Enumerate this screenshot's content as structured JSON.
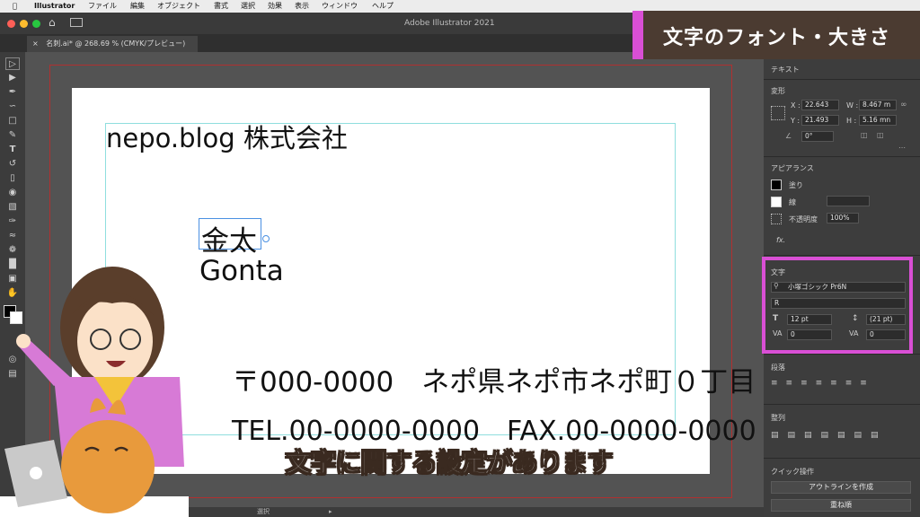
{
  "menubar": {
    "app": "Illustrator",
    "items": [
      "ファイル",
      "編集",
      "オブジェクト",
      "書式",
      "選択",
      "効果",
      "表示",
      "ウィンドウ",
      "ヘルプ"
    ]
  },
  "window": {
    "title": "Adobe Illustrator 2021"
  },
  "document_tab": {
    "label": "名刺.ai* @ 268.69 % (CMYK/プレビュー)",
    "close": "×"
  },
  "artboard": {
    "company": "nepo.blog 株式会社",
    "name_jp": "金太",
    "name_en": "Gonta",
    "address": "〒000-0000　ネポ県ネポ市ネポ町０丁目",
    "contact": "TEL.00-0000-0000　FAX.00-0000-0000"
  },
  "panel": {
    "text_header": "テキスト",
    "transform": {
      "title": "変形",
      "x_label": "X :",
      "x": "22.643",
      "y_label": "Y :",
      "y": "21.493",
      "w_label": "W :",
      "w": "8.467 m",
      "h_label": "H :",
      "h": "5.16 mn",
      "angle": "0°"
    },
    "appearance": {
      "title": "アピアランス",
      "fill": "塗り",
      "stroke": "線",
      "opacity_label": "不透明度",
      "opacity": "100%",
      "fx": "fx."
    },
    "character": {
      "title": "文字",
      "font_family": "小塚ゴシック Pr6N",
      "font_style": "R",
      "font_size": "12 pt",
      "leading": "(21 pt)",
      "kerning": "0",
      "tracking": "0"
    },
    "paragraph": {
      "title": "段落"
    },
    "align": {
      "title": "整列"
    },
    "quick_actions": {
      "title": "クイック操作",
      "outline_button": "アウトラインを作成",
      "arrange_button": "重ね順"
    }
  },
  "statusbar": {
    "tool": "選択"
  },
  "overlay": {
    "banner": "文字のフォント・大きさ",
    "caption": "文字に関する設定があります"
  },
  "colors": {
    "accent": "#d94fd5",
    "banner_bg": "#4b3b31",
    "guide": "#8fdede",
    "bleed": "#b03030"
  }
}
